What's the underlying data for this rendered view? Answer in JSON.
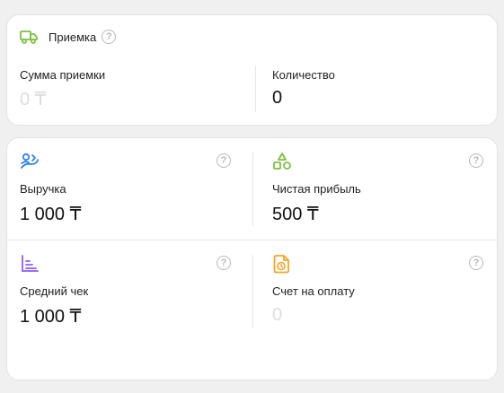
{
  "receipt": {
    "title": "Приемка",
    "help": "?",
    "sum_label": "Сумма приемки",
    "sum_value": "0 ₸",
    "count_label": "Количество",
    "count_value": "0"
  },
  "metrics": {
    "help": "?",
    "revenue": {
      "label": "Выручка",
      "value": "1 000 ₸"
    },
    "profit": {
      "label": "Чистая прибыль",
      "value": "500 ₸"
    },
    "avg_check": {
      "label": "Средний чек",
      "value": "1 000 ₸"
    },
    "invoice": {
      "label": "Счет на оплату",
      "value": "0"
    }
  },
  "colors": {
    "truck": "#7cc142",
    "revenue_icon": "#2f80ed",
    "profit_icon": "#7cc142",
    "avg_icon": "#8b5cf6",
    "invoice_icon": "#f5a623"
  },
  "icons": [
    "truck-icon",
    "hand-coins-icon",
    "shapes-icon",
    "bar-chart-icon",
    "invoice-clock-icon",
    "help-icon"
  ]
}
